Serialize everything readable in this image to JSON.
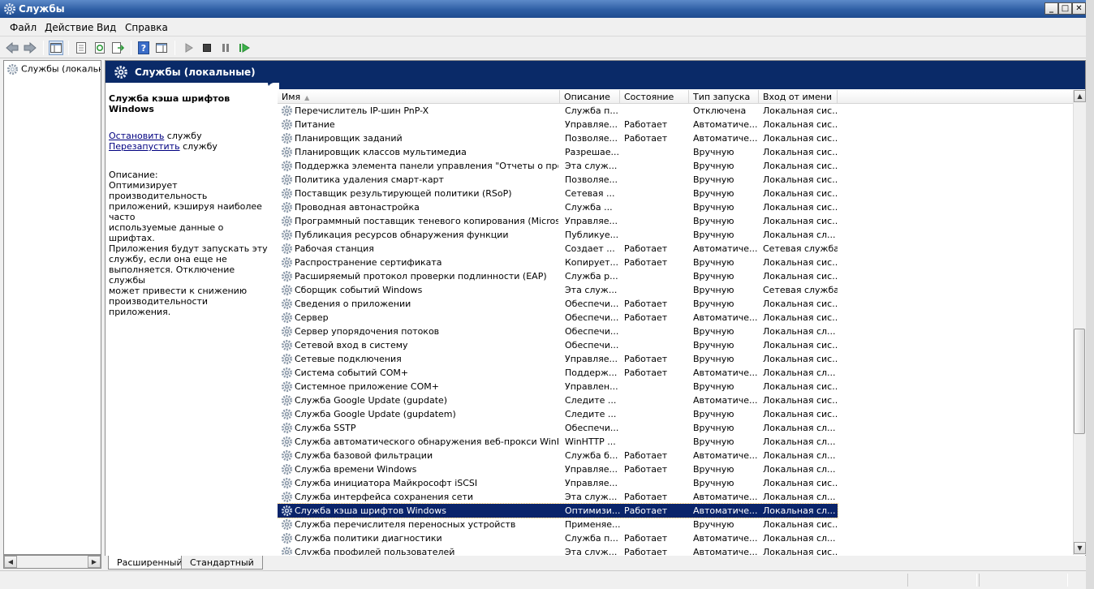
{
  "window": {
    "title": "Службы",
    "min_label": "_",
    "max_label": "□",
    "close_label": "✕"
  },
  "menu": [
    "Файл",
    "Действие",
    "Вид",
    "Справка"
  ],
  "tree": {
    "root": "Службы (локальные)"
  },
  "header": {
    "title": "Службы (локальные)"
  },
  "details": {
    "service_name": "Служба кэша шрифтов Windows",
    "stop_link": "Остановить",
    "stop_suffix": " службу",
    "restart_link": "Перезапустить",
    "restart_suffix": " службу",
    "desc_label": "Описание:",
    "desc_lines": [
      "Оптимизирует производительность",
      "приложений, кэшируя наиболее часто",
      "используемые данные о шрифтах.",
      "Приложения будут запускать эту",
      "службу, если она еще не",
      "выполняется. Отключение службы",
      "может привести к снижению",
      "производительности приложения."
    ]
  },
  "columns": [
    "Имя",
    "Описание",
    "Состояние",
    "Тип запуска",
    "Вход от имени"
  ],
  "rows": [
    [
      "Перечислитель IP-шин PnP-X",
      "Служба п...",
      "",
      "Отключена",
      "Локальная сис..."
    ],
    [
      "Питание",
      "Управляе...",
      "Работает",
      "Автоматиче...",
      "Локальная сис..."
    ],
    [
      "Планировщик заданий",
      "Позволяе...",
      "Работает",
      "Автоматиче...",
      "Локальная сис..."
    ],
    [
      "Планировщик классов мультимедиа",
      "Разрешае...",
      "",
      "Вручную",
      "Локальная сис..."
    ],
    [
      "Поддержка элемента панели управления \"Отчеты о пробле...",
      "Эта служ...",
      "",
      "Вручную",
      "Локальная сис..."
    ],
    [
      "Политика удаления смарт-карт",
      "Позволяе...",
      "",
      "Вручную",
      "Локальная сис..."
    ],
    [
      "Поставщик результирующей политики (RSoP)",
      "Сетевая ...",
      "",
      "Вручную",
      "Локальная сис..."
    ],
    [
      "Проводная автонастройка",
      "Служба ...",
      "",
      "Вручную",
      "Локальная сис..."
    ],
    [
      "Программный поставщик теневого копирования (Microsoft)",
      "Управляе...",
      "",
      "Вручную",
      "Локальная сис..."
    ],
    [
      "Публикация ресурсов обнаружения функции",
      "Публикуе...",
      "",
      "Вручную",
      "Локальная сл..."
    ],
    [
      "Рабочая станция",
      "Создает ...",
      "Работает",
      "Автоматиче...",
      "Сетевая служба"
    ],
    [
      "Распространение сертификата",
      "Копирует...",
      "Работает",
      "Вручную",
      "Локальная сис..."
    ],
    [
      "Расширяемый протокол проверки подлинности (EAP)",
      "Служба р...",
      "",
      "Вручную",
      "Локальная сис..."
    ],
    [
      "Сборщик событий Windows",
      "Эта служ...",
      "",
      "Вручную",
      "Сетевая служба"
    ],
    [
      "Сведения о приложении",
      "Обеспечи...",
      "Работает",
      "Вручную",
      "Локальная сис..."
    ],
    [
      "Сервер",
      "Обеспечи...",
      "Работает",
      "Автоматиче...",
      "Локальная сис..."
    ],
    [
      "Сервер упорядочения потоков",
      "Обеспечи...",
      "",
      "Вручную",
      "Локальная сл..."
    ],
    [
      "Сетевой вход в систему",
      "Обеспечи...",
      "",
      "Вручную",
      "Локальная сис..."
    ],
    [
      "Сетевые подключения",
      "Управляе...",
      "Работает",
      "Вручную",
      "Локальная сис..."
    ],
    [
      "Система событий COM+",
      "Поддерж...",
      "Работает",
      "Автоматиче...",
      "Локальная сл..."
    ],
    [
      "Системное приложение COM+",
      "Управлен...",
      "",
      "Вручную",
      "Локальная сис..."
    ],
    [
      "Служба Google Update (gupdate)",
      "Следите ...",
      "",
      "Автоматиче...",
      "Локальная сис..."
    ],
    [
      "Служба Google Update (gupdatem)",
      "Следите ...",
      "",
      "Вручную",
      "Локальная сис..."
    ],
    [
      "Служба SSTP",
      "Обеспечи...",
      "",
      "Вручную",
      "Локальная сл..."
    ],
    [
      "Служба автоматического обнаружения веб-прокси WinHTTP",
      "WinHTTP ...",
      "",
      "Вручную",
      "Локальная сл..."
    ],
    [
      "Служба базовой фильтрации",
      "Служба б...",
      "Работает",
      "Автоматиче...",
      "Локальная сл..."
    ],
    [
      "Служба времени Windows",
      "Управляе...",
      "Работает",
      "Вручную",
      "Локальная сл..."
    ],
    [
      "Служба инициатора Майкрософт iSCSI",
      "Управляе...",
      "",
      "Вручную",
      "Локальная сис..."
    ],
    [
      "Служба интерфейса сохранения сети",
      "Эта служ...",
      "Работает",
      "Автоматиче...",
      "Локальная сл..."
    ],
    [
      "Служба кэша шрифтов Windows",
      "Оптимизи...",
      "Работает",
      "Автоматиче...",
      "Локальная сл..."
    ],
    [
      "Служба перечислителя переносных устройств",
      "Применяе...",
      "",
      "Вручную",
      "Локальная сис..."
    ],
    [
      "Служба политики диагностики",
      "Служба п...",
      "Работает",
      "Автоматиче...",
      "Локальная сл..."
    ],
    [
      "Служба профилей пользователей",
      "Эта служ...",
      "Работает",
      "Автоматиче...",
      "Локальная сис..."
    ]
  ],
  "selected_row": 29,
  "tabs": [
    "Расширенный",
    "Стандартный"
  ],
  "colors": {
    "selection": "#0a246a",
    "header": "#0a2a68",
    "link": "#000080"
  }
}
